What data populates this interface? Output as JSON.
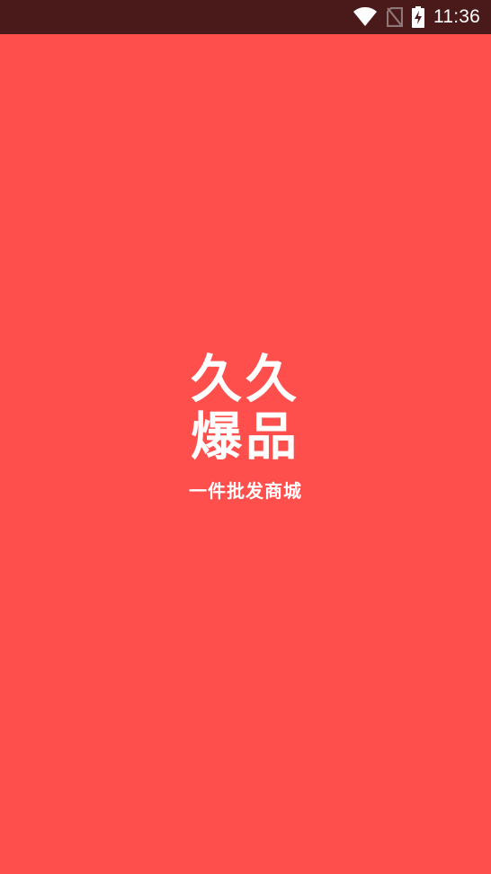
{
  "colors": {
    "status_bar_bg": "#4a1a1a",
    "splash_bg": "#ff4f4d",
    "text": "#ffffff",
    "icon_dim": "#8f7777"
  },
  "status_bar": {
    "icons": [
      "wifi-icon",
      "no-sim-icon",
      "battery-charging-icon"
    ],
    "time": "11:36"
  },
  "splash": {
    "logo_line_1": "久久",
    "logo_line_2": "爆品",
    "slogan": "一件批发商城"
  }
}
